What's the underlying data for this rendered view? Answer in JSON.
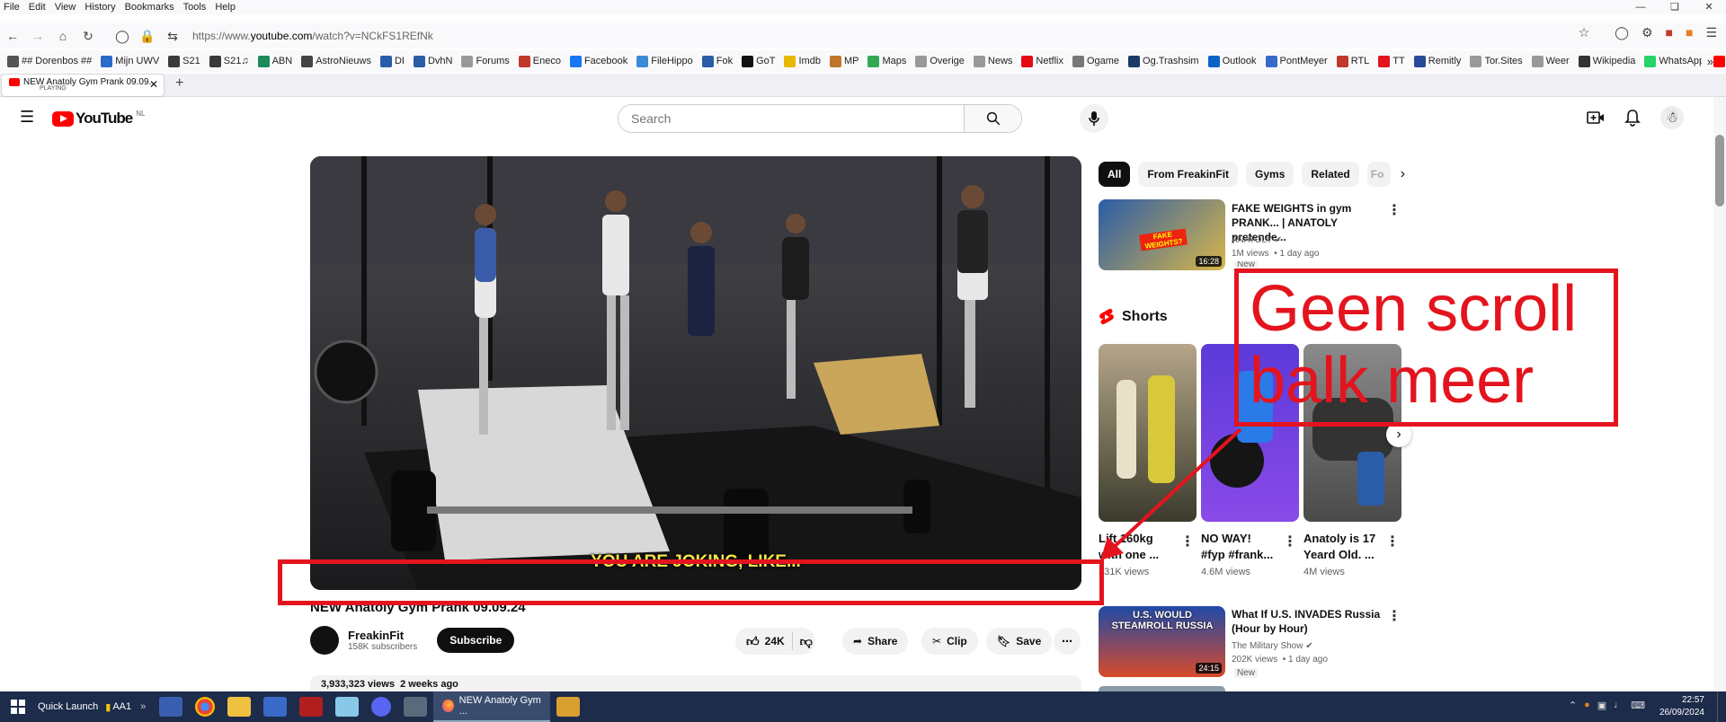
{
  "browser": {
    "menu": [
      "File",
      "Edit",
      "View",
      "History",
      "Bookmarks",
      "Tools",
      "Help"
    ],
    "url_prefix": "https://www.",
    "url_domain": "youtube.com",
    "url_path": "/watch?v=NCkFS1REfNk",
    "tab_title": "NEW Anatoly Gym Prank 09.09.",
    "tab_status": "PLAYING",
    "bookmarks": [
      "## Dorenbos ##",
      "Mijn UWV",
      "S21",
      "S21♫",
      "ABN",
      "AstroNieuws",
      "DI",
      "DvhN",
      "Forums",
      "Eneco",
      "Facebook",
      "FileHippo",
      "Fok",
      "GoT",
      "Imdb",
      "MP",
      "Maps",
      "Overige",
      "News",
      "Netflix",
      "Ogame",
      "Og.Trashsim",
      "Outlook",
      "PontMeyer",
      "RTL",
      "TT",
      "Remitly",
      "Tor.Sites",
      "Weer",
      "Wikipedia",
      "WhatsApp",
      "YouTube"
    ]
  },
  "youtube": {
    "logo_text": "YouTube",
    "region": "NL",
    "search_placeholder": "Search"
  },
  "video": {
    "caption": "YOU ARE JOKING, LIKE...",
    "title": "NEW Anatoly Gym Prank 09.09.24",
    "channel": "FreakinFit",
    "subscribers": "158K subscribers",
    "subscribe_label": "Subscribe",
    "likes": "24K",
    "share_label": "Share",
    "clip_label": "Clip",
    "save_label": "Save",
    "stats": "3,933,323 views  2 weeks ago"
  },
  "chips": [
    "All",
    "From FreakinFit",
    "Gyms",
    "Related",
    "Fo"
  ],
  "related": [
    {
      "title_l1": "FAKE WEIGHTS in gym",
      "title_l2": "PRANK... | ANATOLY pretende...",
      "channel": "ANATOLY",
      "meta": "1M views  • 1 day ago",
      "badge": "New",
      "duration": "16:28",
      "thumb_text": "FAKE WEIGHTS?"
    },
    {
      "title_l1": "What If U.S. INVADES Russia",
      "title_l2": "(Hour by Hour)",
      "channel": "The Military Show",
      "meta": "202K views  • 1 day ago",
      "badge": "New",
      "duration": "24:15",
      "thumb_text": "U.S. WOULD STEAMROLL RUSSIA"
    }
  ],
  "shorts": {
    "heading": "Shorts",
    "items": [
      {
        "l1": "Lift 160kg",
        "l2": "with one ...",
        "views": "331K views"
      },
      {
        "l1": "NO WAY!",
        "l2": "#fyp #frank...",
        "views": "4.6M views"
      },
      {
        "l1": "Anatoly is 17",
        "l2": "Yeard Old. ...",
        "views": "4M views"
      }
    ]
  },
  "annotation": {
    "line1": "Geen scroll",
    "line2": "balk meer",
    "color": "#e4141e"
  },
  "taskbar": {
    "quick_launch": "Quick Launch",
    "aa1": "AA1",
    "firefox_task": "NEW Anatoly Gym ...",
    "time": "22:57",
    "date": "26/09/2024"
  }
}
